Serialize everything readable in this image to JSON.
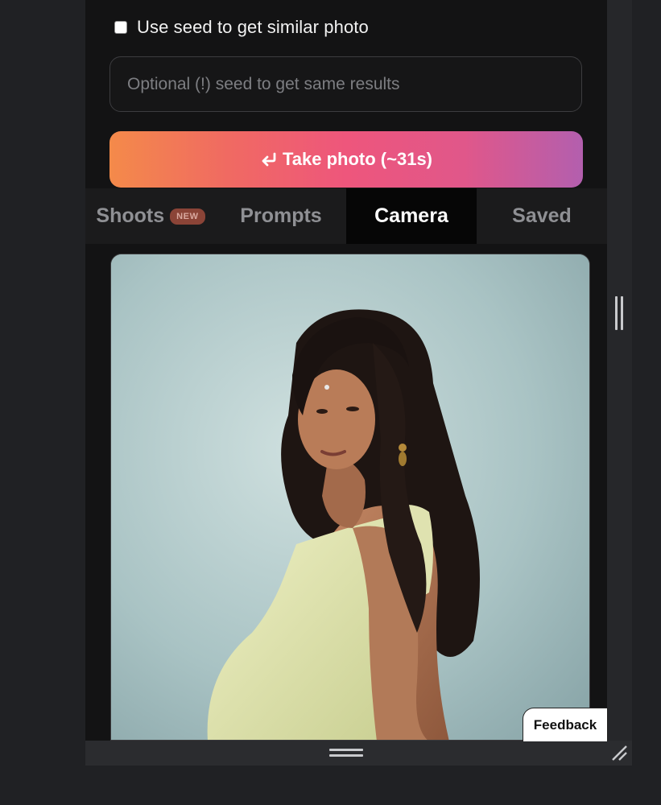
{
  "seed_option": {
    "checkbox_label": "Use seed to get similar photo",
    "checked": false
  },
  "seed_input": {
    "value": "",
    "placeholder": "Optional (!) seed to get same results"
  },
  "take_photo": {
    "icon": "enter-return-icon",
    "label": "Take photo (~31s)"
  },
  "tabs": [
    {
      "label": "Shoots",
      "badge": "NEW",
      "active": false
    },
    {
      "label": "Prompts",
      "active": false
    },
    {
      "label": "Camera",
      "active": true
    },
    {
      "label": "Saved",
      "active": false
    }
  ],
  "feedback": {
    "label": "Feedback"
  },
  "colors": {
    "background": "#202124",
    "panel": "#131314",
    "gradient_start": "#f48a4a",
    "gradient_mid": "#ee567c",
    "gradient_end": "#b35fae",
    "badge": "#8b4437"
  }
}
